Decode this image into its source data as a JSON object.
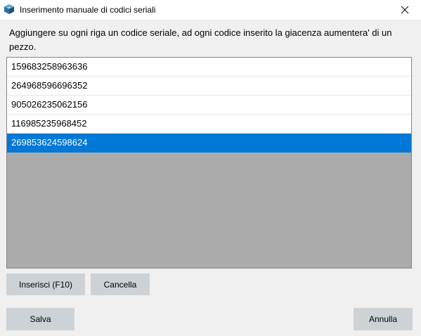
{
  "window": {
    "title": "Inserimento manuale di codici seriali",
    "icon": "app-cube-icon",
    "close_icon": "close-icon"
  },
  "instructions": "Aggiungere su ogni riga un codice seriale, ad ogni codice inserito la giacenza aumentera' di un pezzo.",
  "serials": [
    "159683258963636",
    "264968596696352",
    "905026235062156",
    "116985235968452",
    "269853624598624"
  ],
  "selected_index": 4,
  "buttons": {
    "insert": "Inserisci (F10)",
    "clear": "Cancella",
    "save": "Salva",
    "cancel": "Annulla"
  },
  "colors": {
    "selection": "#0078d7",
    "list_background": "#ababab",
    "button_background": "#cdd2d6"
  }
}
